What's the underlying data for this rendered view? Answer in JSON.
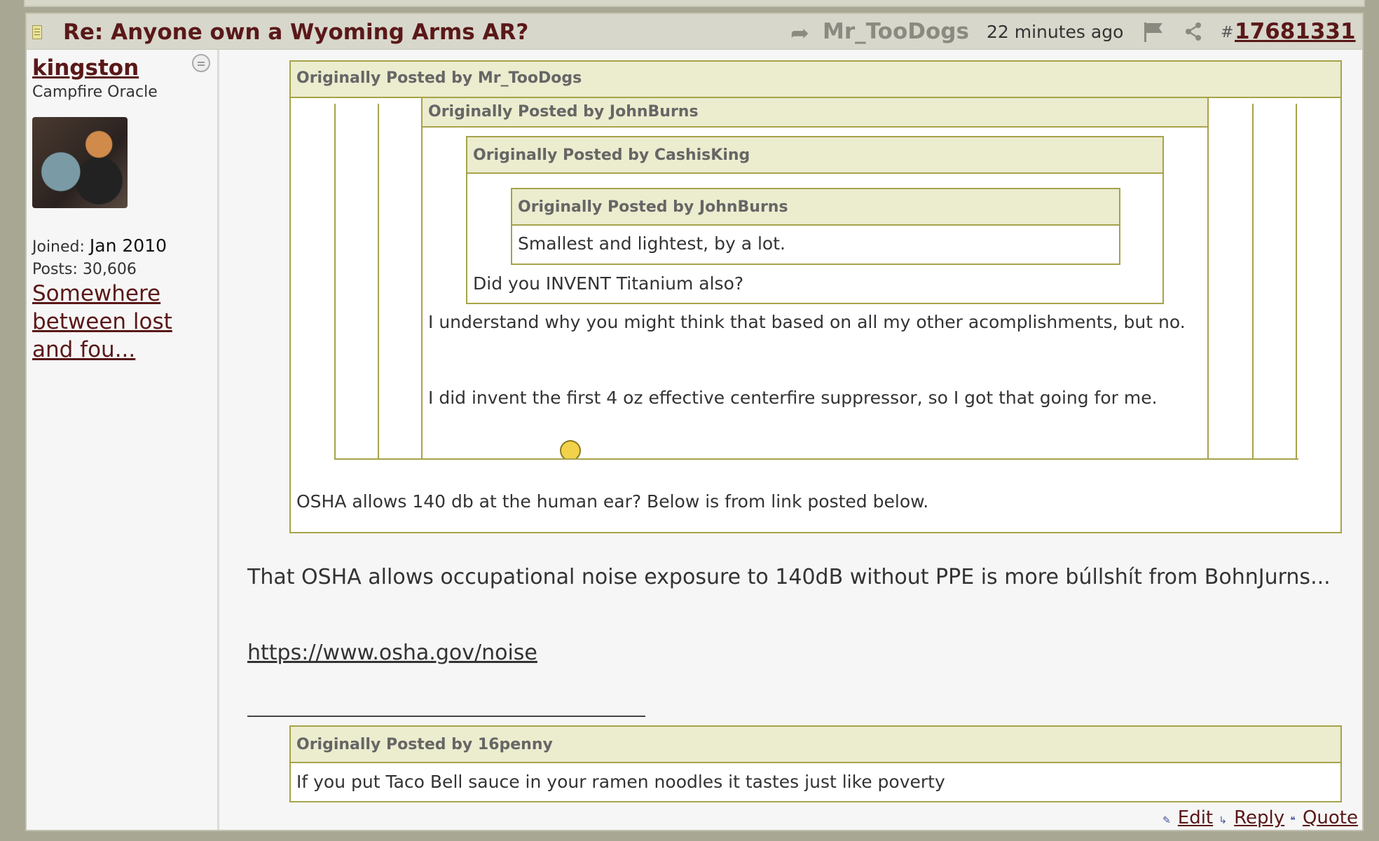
{
  "post": {
    "title": "Re: Anyone own a Wyoming Arms AR?",
    "reply_to_author": "Mr_TooDogs",
    "time_ago": "22 minutes ago",
    "hash": "#",
    "post_number": "17681331"
  },
  "user": {
    "username": "kingston",
    "rank": "Campfire Oracle",
    "joined_label": "Joined:",
    "joined_value": "Jan 2010",
    "posts_label": "Posts:",
    "posts_value": "30,606",
    "location": "Somewhere between lost and fou..."
  },
  "quotes": {
    "outer_head": "Originally Posted by Mr_TooDogs",
    "level2_head": "Originally Posted by JohnBurns",
    "level3_head": "Originally Posted by CashisKing",
    "level4_head": "Originally Posted by JohnBurns",
    "level4_text": "Smallest and lightest, by a lot.",
    "level3_text": "Did you INVENT Titanium also?",
    "level2_text1": "I understand why you might think that based on all my other acomplishments, but no.",
    "level2_text2": "I did invent the first 4 oz effective centerfire suppressor, so I got that going for me.",
    "outer_text": "OSHA allows 140 db at the human ear? Below is from link posted below."
  },
  "body": {
    "text": "That OSHA allows occupational noise exposure to 140dB without PPE is more búllshít from BohnJurns...",
    "link": "https://www.osha.gov/noise"
  },
  "signature": {
    "head": "Originally Posted by 16penny",
    "text": "If you put Taco Bell sauce in your ramen noodles it tastes just like poverty"
  },
  "actions": {
    "edit": "Edit",
    "reply": "Reply",
    "quote": "Quote"
  },
  "colors": {
    "header_bg": "#d7d7cc",
    "title_color": "#5a1818",
    "quote_border": "#a6a34a",
    "quote_head_bg": "#ececcf"
  }
}
